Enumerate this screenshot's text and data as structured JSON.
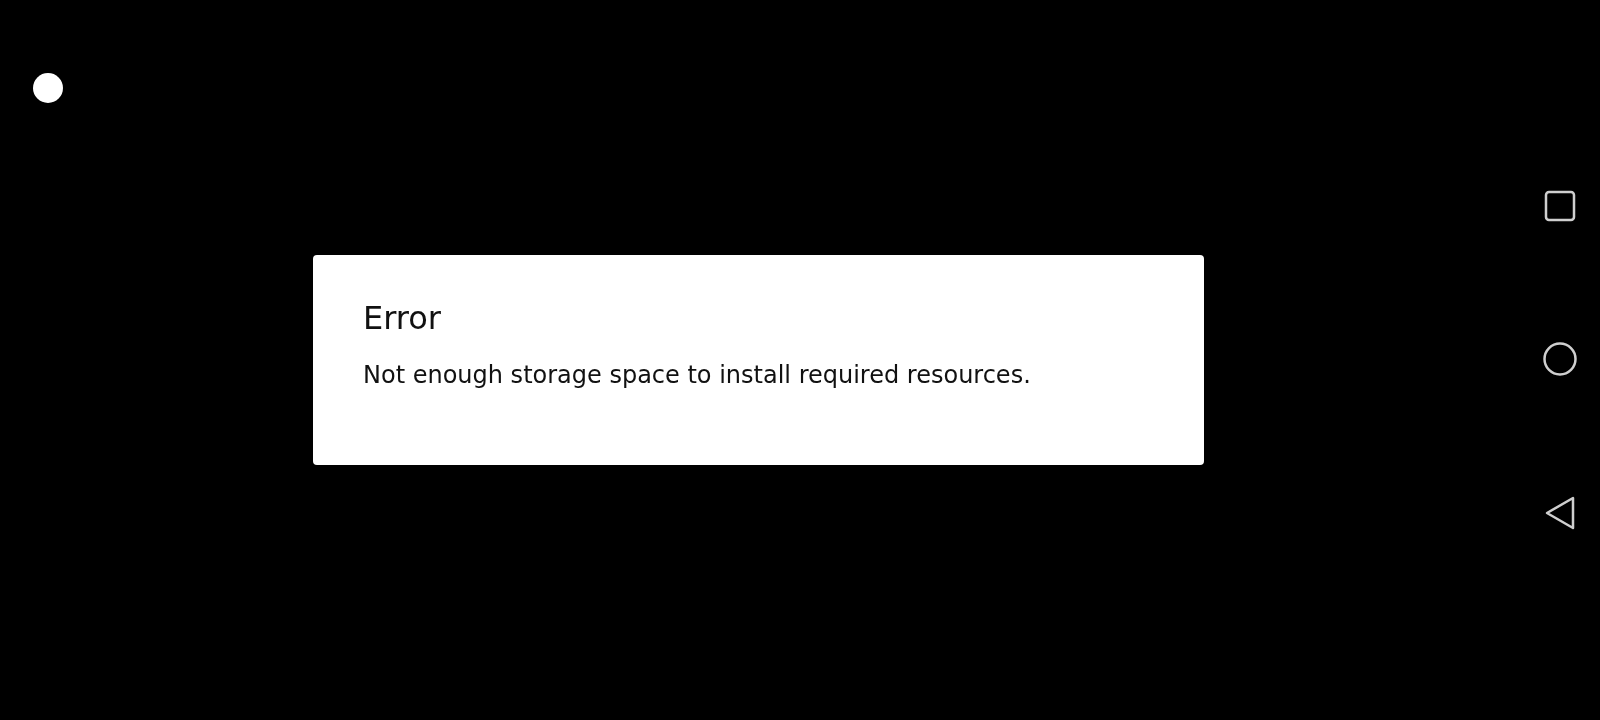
{
  "dialog": {
    "title": "Error",
    "message": "Not enough storage space to install required resources."
  }
}
